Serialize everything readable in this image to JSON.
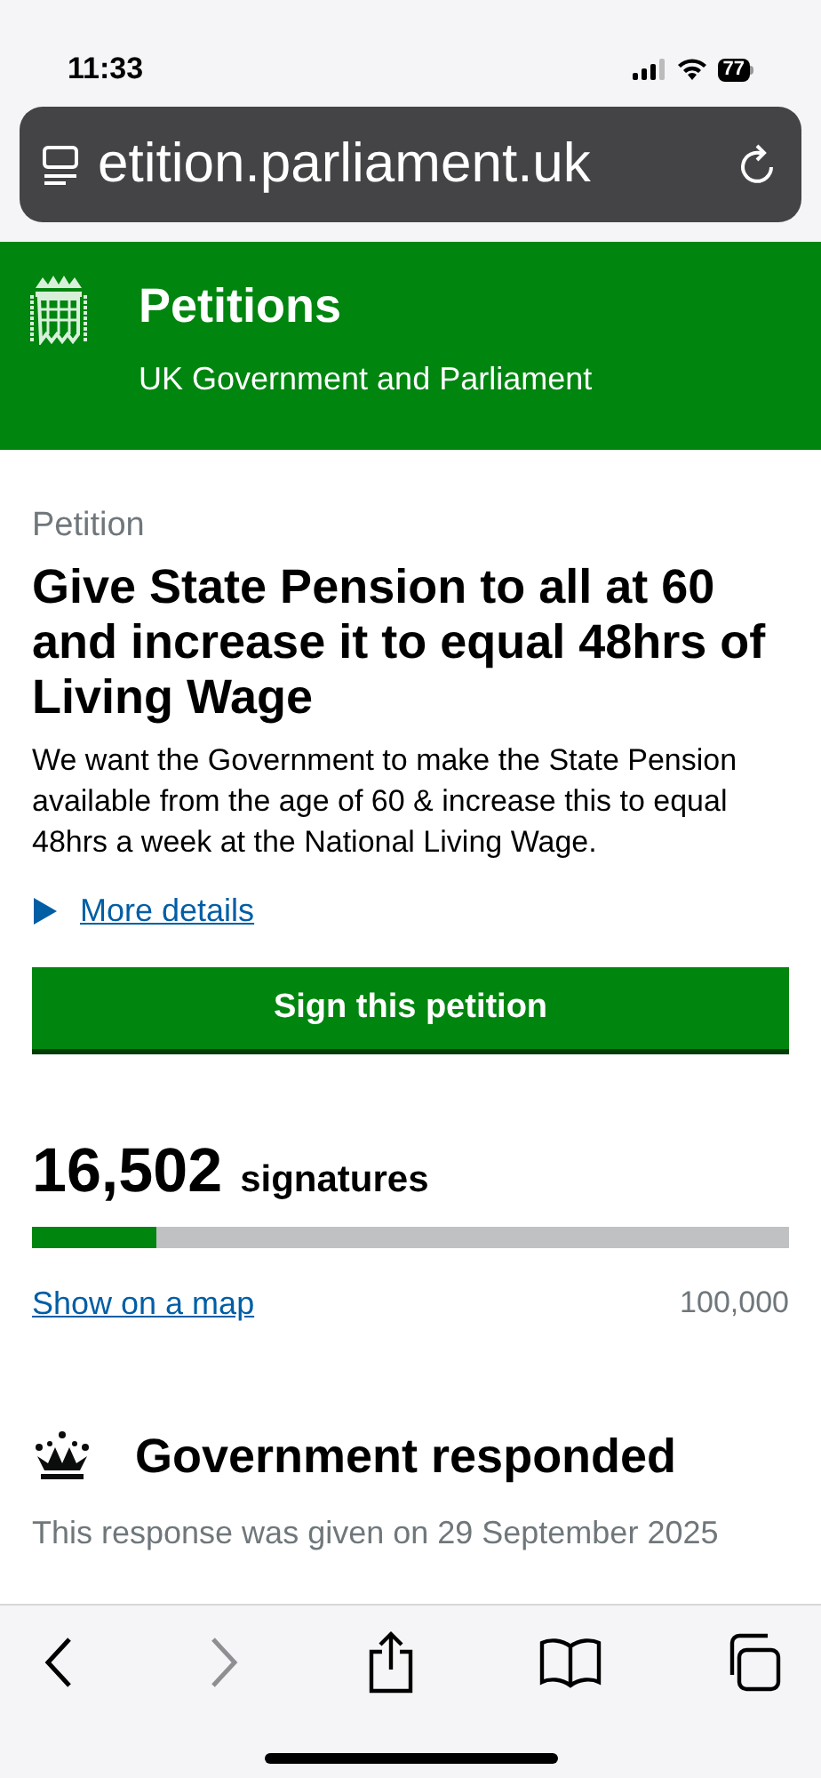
{
  "status_bar": {
    "time": "11:33",
    "battery": "77"
  },
  "address_bar": {
    "url": "etition.parliament.uk"
  },
  "header": {
    "title": "Petitions",
    "subtitle": "UK Government and Parliament"
  },
  "petition": {
    "label": "Petition",
    "title": "Give State Pension to all at 60 and increase it to equal 48hrs of Living Wage",
    "summary": "We want the Government to make the State Pension available from the age of 60 & increase this to equal 48hrs a week at the National Living Wage.",
    "details_link": "More details",
    "details_expanded": false,
    "sign_button": "Sign this petition"
  },
  "signatures": {
    "count": "16,502",
    "unit": "signatures",
    "level": 0.165,
    "map_link": "Show on a map",
    "target": "100,000"
  },
  "response": {
    "title": "Government responded",
    "date": "This response was given on 29 September 2025"
  },
  "toolbar": {
    "forward_disabled": true
  }
}
